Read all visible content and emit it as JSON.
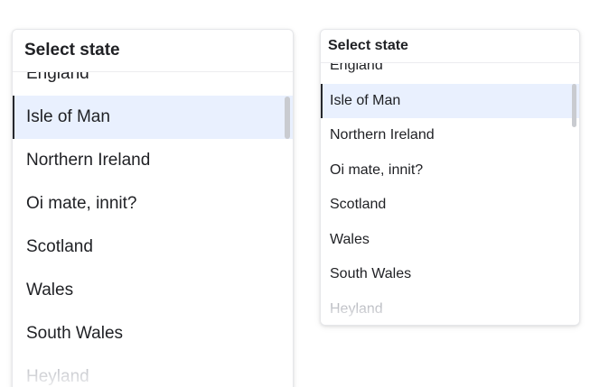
{
  "dropdowns": [
    {
      "title": "Select state",
      "selected_index": 1,
      "items": [
        {
          "label": "England"
        },
        {
          "label": "Isle of Man"
        },
        {
          "label": "Northern Ireland"
        },
        {
          "label": "Oi mate, innit?"
        },
        {
          "label": "Scotland"
        },
        {
          "label": "Wales"
        },
        {
          "label": "South Wales"
        },
        {
          "label": "Heyland"
        }
      ]
    },
    {
      "title": "Select state",
      "selected_index": 1,
      "items": [
        {
          "label": "England"
        },
        {
          "label": "Isle of Man"
        },
        {
          "label": "Northern Ireland"
        },
        {
          "label": "Oi mate, innit?"
        },
        {
          "label": "Scotland"
        },
        {
          "label": "Wales"
        },
        {
          "label": "South Wales"
        },
        {
          "label": "Heyland"
        }
      ]
    }
  ],
  "colors": {
    "selected_background": "#e9f0fe",
    "selected_indicator": "#26282c",
    "scrollbar_thumb": "#c9cbd0",
    "text": "#1f2024",
    "faded_text": "#b9bbc1"
  }
}
